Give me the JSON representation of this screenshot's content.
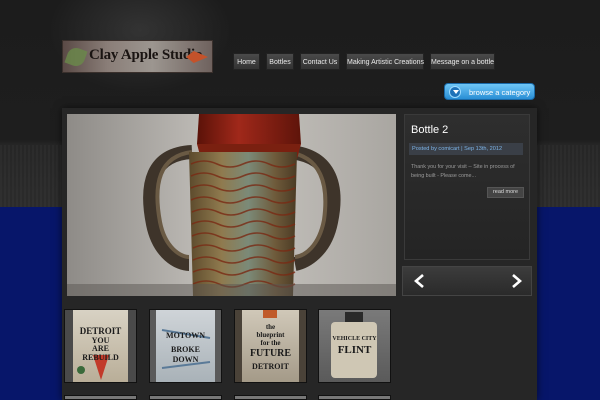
{
  "logo": {
    "text": "Clay Apple Studio"
  },
  "nav": {
    "items": [
      {
        "label": "Home"
      },
      {
        "label": "Bottles"
      },
      {
        "label": "Contact Us"
      },
      {
        "label": "Making Artistic Creations"
      },
      {
        "label": "Message on a bottle"
      }
    ]
  },
  "browse": {
    "label": "browse a category",
    "icon": "chevron-down-icon"
  },
  "featured": {
    "title": "Bottle 2",
    "meta": "Posted by comicart | Sep 13th, 2012",
    "excerpt": "Thank you for your visit -- Site in process of being built - Please come...",
    "read_more": "read more"
  },
  "slider": {
    "prev_icon": "arrow-left-icon",
    "next_icon": "arrow-right-icon"
  },
  "thumbnails": [
    {
      "lines": [
        "DETROIT",
        "YOU",
        "ARE",
        "REBUILD"
      ]
    },
    {
      "lines": [
        "MOTOWN",
        "BROKE",
        "DOWN"
      ]
    },
    {
      "lines": [
        "the",
        "blueprint",
        "for the",
        "FUTURE",
        "DETROIT"
      ]
    },
    {
      "lines": [
        "VEHICLE CITY",
        "FLINT"
      ]
    }
  ],
  "colors": {
    "accent_blue": "#3aa0e6",
    "meta_link": "#7cb4e8",
    "page_dark": "#1e1e1e",
    "page_navy": "#07166a"
  }
}
